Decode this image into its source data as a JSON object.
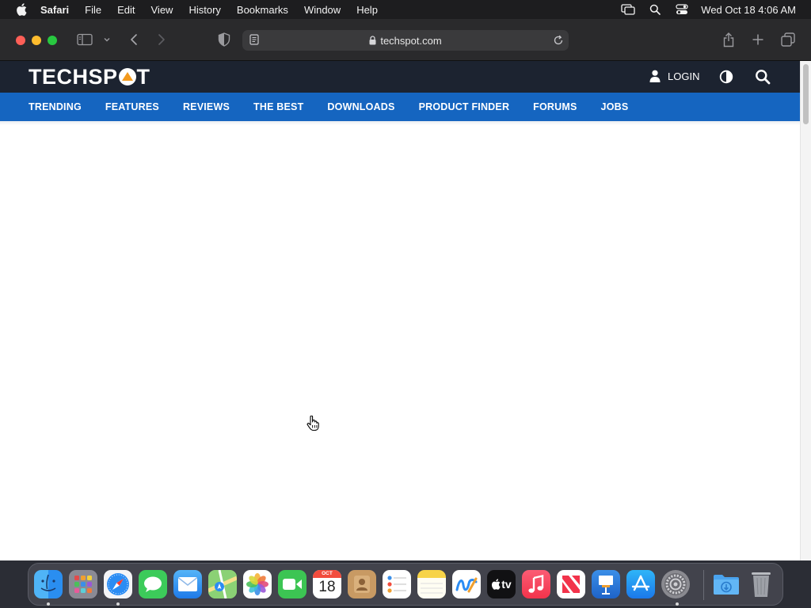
{
  "menubar": {
    "app_name": "Safari",
    "items": [
      "File",
      "Edit",
      "View",
      "History",
      "Bookmarks",
      "Window",
      "Help"
    ],
    "clock": "Wed Oct 18  4:06 AM"
  },
  "browser": {
    "url": "techspot.com"
  },
  "site": {
    "logo_text_left": "TECHSP",
    "logo_text_right": "T",
    "login_label": "LOGIN",
    "nav": [
      "TRENDING",
      "FEATURES",
      "REVIEWS",
      "THE BEST",
      "DOWNLOADS",
      "PRODUCT FINDER",
      "FORUMS",
      "JOBS"
    ],
    "colors": {
      "header": "#1c2330",
      "nav": "#1565c0",
      "logo_accent": "#f39a1d"
    }
  },
  "dock": {
    "calendar_month": "OCT",
    "calendar_day": "18",
    "tv_label": "tv",
    "apps": [
      "finder",
      "launchpad",
      "safari",
      "messages",
      "mail",
      "maps",
      "photos",
      "facetime",
      "calendar",
      "contacts",
      "reminders",
      "notes",
      "freeform",
      "tv",
      "music",
      "news",
      "keynote",
      "app-store",
      "system-settings",
      "downloads",
      "trash"
    ]
  }
}
